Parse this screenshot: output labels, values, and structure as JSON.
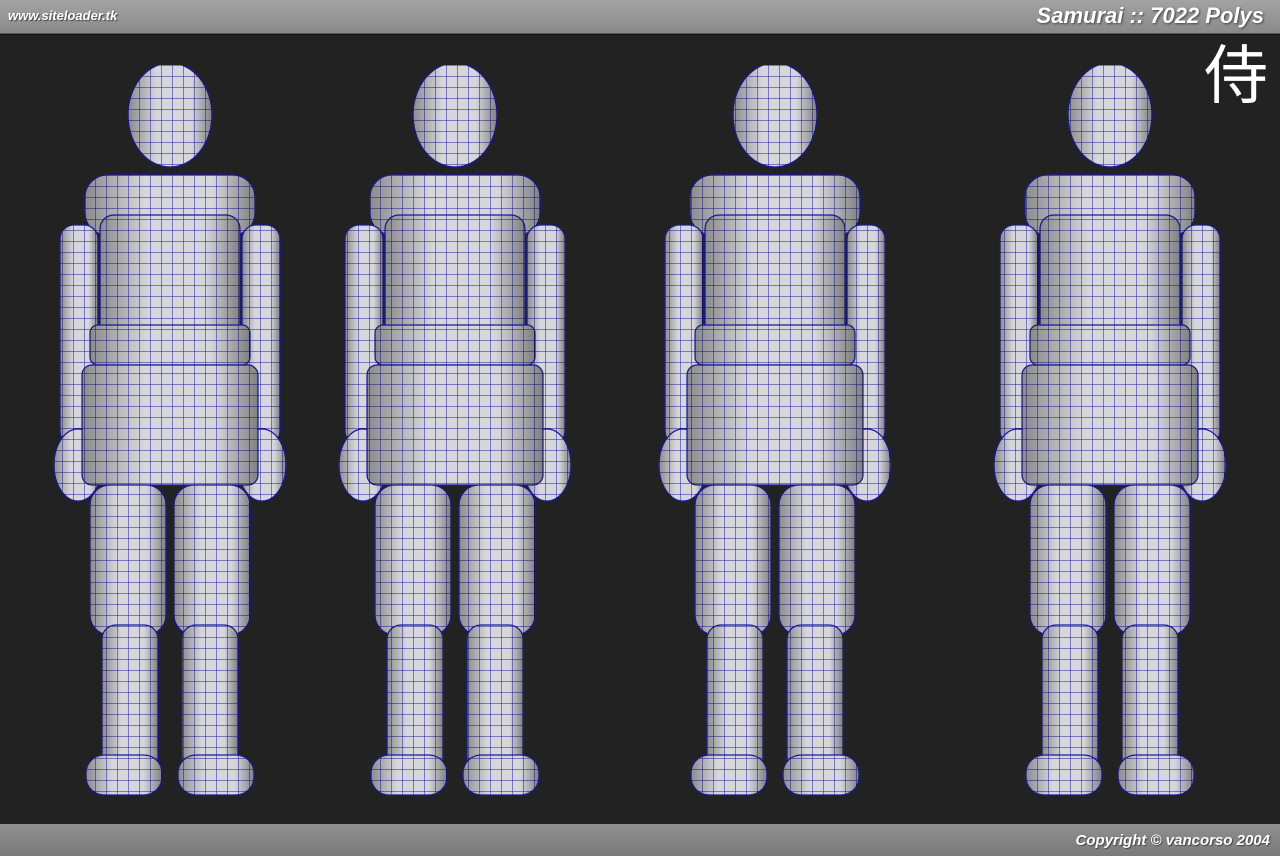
{
  "header": {
    "site_url": "www.siteloader.tk",
    "title": "Samurai :: 7022 Polys"
  },
  "viewport": {
    "kanji": "侍",
    "background_color": "#222222",
    "mesh_fill_color": "#d6d6dc",
    "wireframe_color": "#1a1aa0",
    "views": [
      "front-three-quarter",
      "front-three-quarter-right",
      "back",
      "back-three-quarter"
    ]
  },
  "footer": {
    "copyright": "Copyright © vancorso 2004"
  }
}
